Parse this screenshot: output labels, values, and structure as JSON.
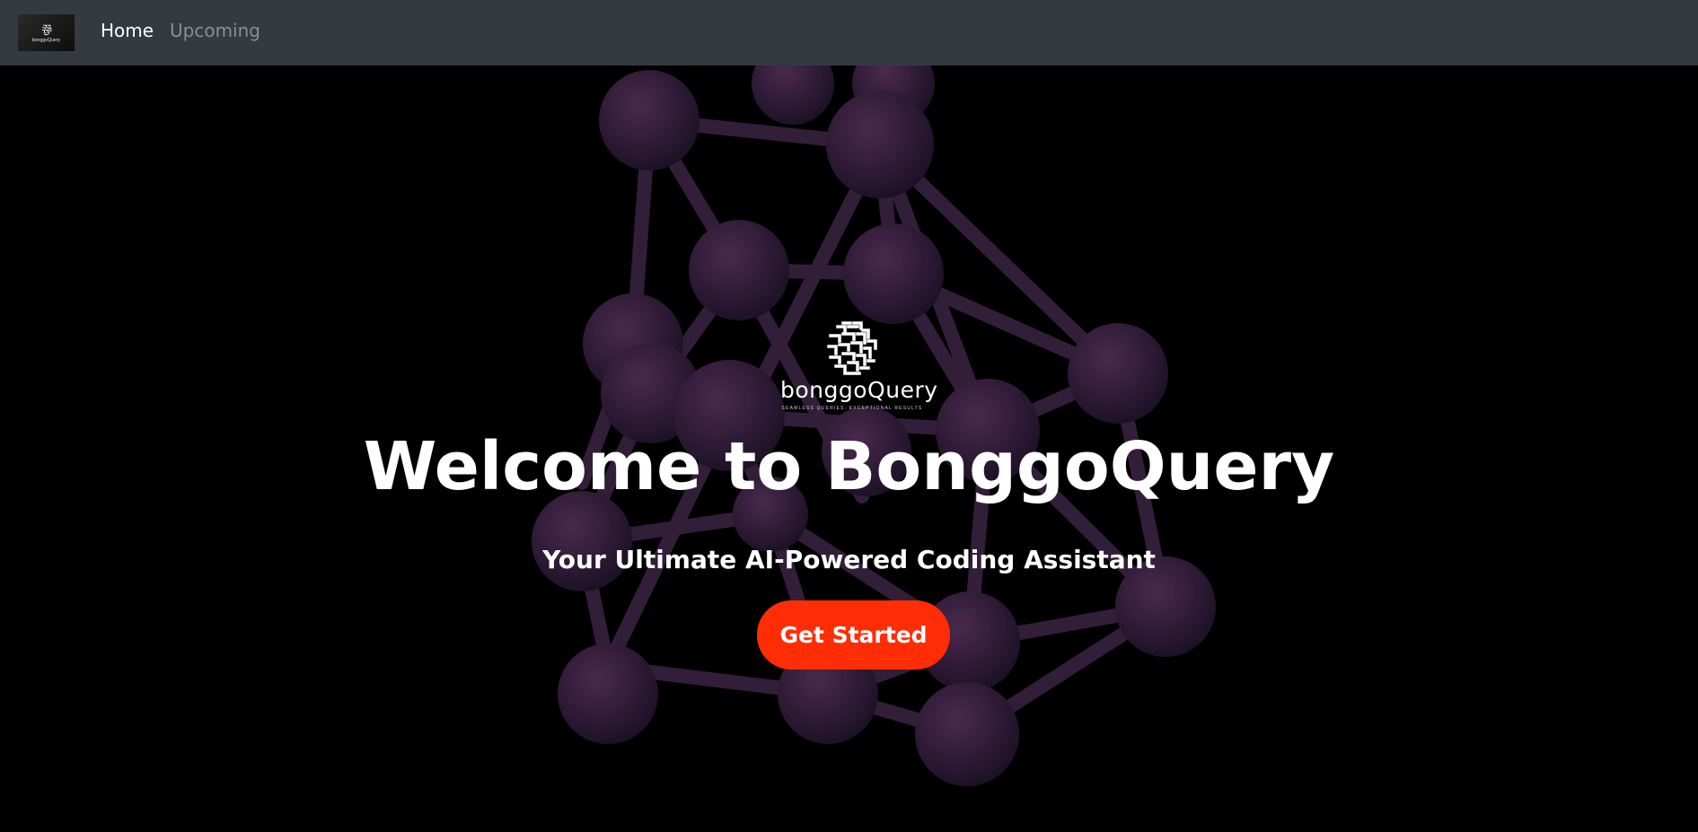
{
  "navbar": {
    "brand": {
      "logo_text": "bonggoQuery",
      "icon": "maze-logo-icon"
    },
    "links": [
      {
        "label": "Home",
        "active": true
      },
      {
        "label": "Upcoming",
        "active": false
      }
    ]
  },
  "hero": {
    "logo": {
      "icon": "maze-logo-icon",
      "wordmark": "bonggoQuery",
      "tagline": "SEAMLESS QUERIES. EXCEPTIONAL RESULTS"
    },
    "title": "Welcome to BonggoQuery",
    "subtitle": "Your Ultimate AI-Powered Coding Assistant",
    "cta_label": "Get Started",
    "background_image": "molecule-structure-illustration"
  },
  "colors": {
    "navbar_bg": "#343a40",
    "page_bg": "#000000",
    "accent": "#ff2d06",
    "nav_active": "#ffffff",
    "nav_inactive": "#868e96",
    "molecule_tint": "#3d2440"
  }
}
